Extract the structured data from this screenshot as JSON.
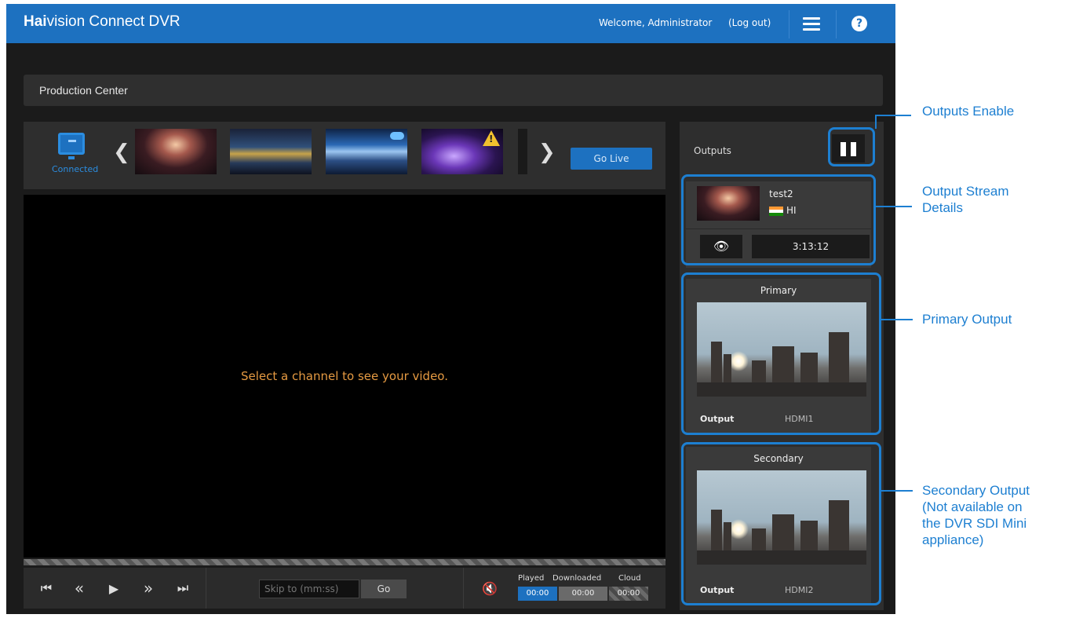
{
  "header": {
    "brand_bold": "Hai",
    "brand_rest": "vision Connect DVR",
    "welcome": "Welcome, Administrator",
    "logout": "(Log out)",
    "menu_icon": "hamburger-icon",
    "help_icon": "help-icon",
    "help_glyph": "?"
  },
  "production": {
    "title": "Production Center"
  },
  "channels": {
    "connected_label": "Connected",
    "prev_glyph": "❮",
    "next_glyph": "❯",
    "go_live": "Go Live"
  },
  "video": {
    "message": "Select a channel to see your video."
  },
  "playback": {
    "skip_placeholder": "Skip to (mm:ss)",
    "go": "Go",
    "buttons": [
      "⏮",
      "«",
      "▶",
      "»",
      "⏭"
    ],
    "mute_glyph": "🔇",
    "labels": {
      "played": "Played",
      "downloaded": "Downloaded",
      "cloud": "Cloud"
    },
    "values": {
      "played": "00:00",
      "downloaded": "00:00",
      "cloud": "00:00"
    }
  },
  "outputs": {
    "title": "Outputs",
    "stream": {
      "name": "test2",
      "lang": "HI",
      "duration": "3:13:12",
      "eye_glyph": "👁"
    },
    "primary": {
      "title": "Primary",
      "label": "Output",
      "value": "HDMI1"
    },
    "secondary": {
      "title": "Secondary",
      "label": "Output",
      "value": "HDMI2"
    }
  },
  "annotations": {
    "outputs_enable": "Outputs Enable",
    "stream_details_1": "Output Stream",
    "stream_details_2": "Details",
    "primary_output": "Primary Output",
    "secondary_1": "Secondary Output",
    "secondary_2": "(Not available on",
    "secondary_3": "the DVR SDI Mini",
    "secondary_4": "appliance)"
  },
  "colors": {
    "brand_blue": "#1d71c0",
    "callout_blue": "#1d7fd1",
    "message_orange": "#e59a42"
  }
}
